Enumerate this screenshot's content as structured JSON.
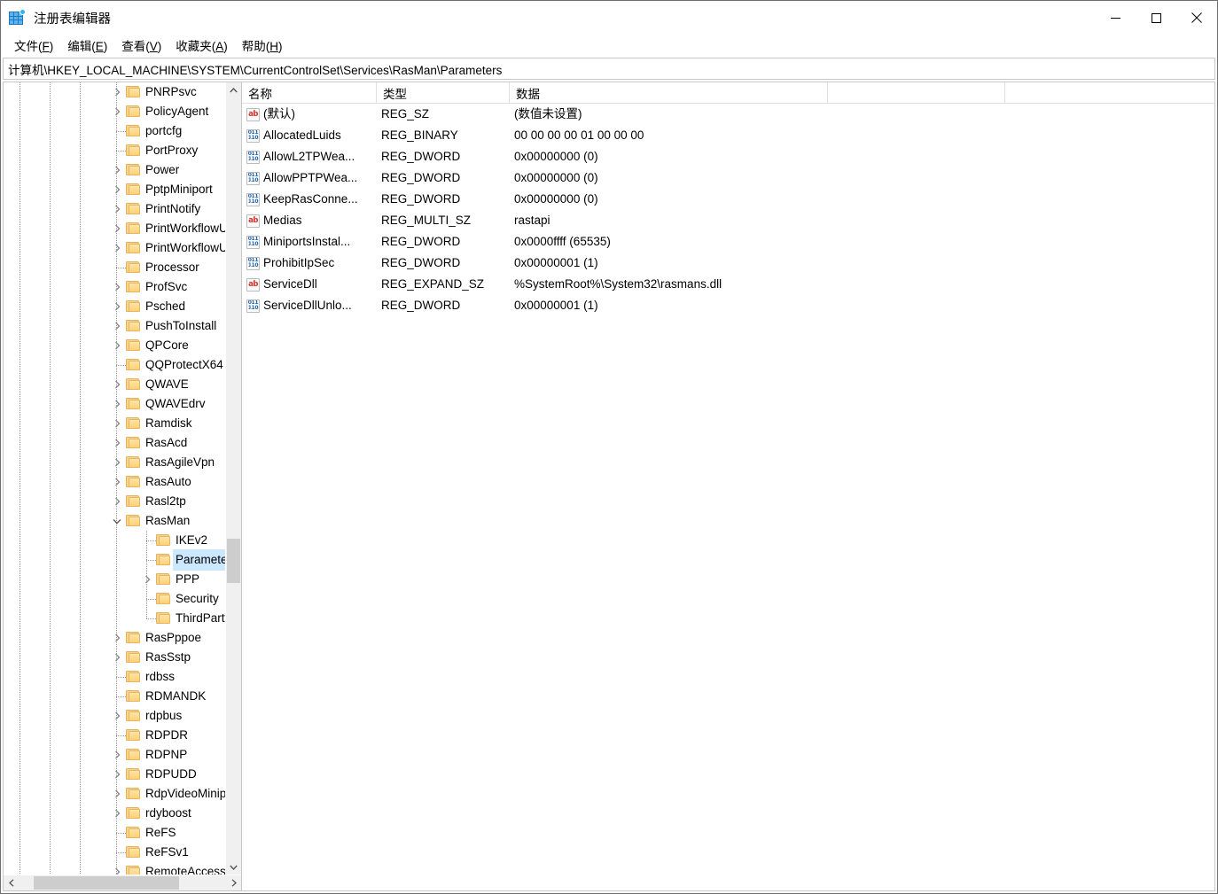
{
  "window": {
    "title": "注册表编辑器",
    "icon": "registry-editor-icon",
    "controls": {
      "minimize": "minimize-icon",
      "maximize": "maximize-icon",
      "close": "close-icon"
    }
  },
  "menubar": {
    "items": [
      {
        "label": "文件(F)",
        "plain": "文件",
        "accel": "F"
      },
      {
        "label": "编辑(E)",
        "plain": "编辑",
        "accel": "E"
      },
      {
        "label": "查看(V)",
        "plain": "查看",
        "accel": "V"
      },
      {
        "label": "收藏夹(A)",
        "plain": "收藏夹",
        "accel": "A"
      },
      {
        "label": "帮助(H)",
        "plain": "帮助",
        "accel": "H"
      }
    ]
  },
  "address": {
    "path": "计算机\\HKEY_LOCAL_MACHINE\\SYSTEM\\CurrentControlSet\\Services\\RasMan\\Parameters"
  },
  "tree": {
    "selected": "Parameters",
    "nodes": [
      {
        "label": "PNRPsvc",
        "depth": 0,
        "expander": "collapsed"
      },
      {
        "label": "PolicyAgent",
        "depth": 0,
        "expander": "collapsed"
      },
      {
        "label": "portcfg",
        "depth": 0,
        "expander": "none"
      },
      {
        "label": "PortProxy",
        "depth": 0,
        "expander": "none"
      },
      {
        "label": "Power",
        "depth": 0,
        "expander": "collapsed"
      },
      {
        "label": "PptpMiniport",
        "depth": 0,
        "expander": "collapsed"
      },
      {
        "label": "PrintNotify",
        "depth": 0,
        "expander": "collapsed"
      },
      {
        "label": "PrintWorkflowUse",
        "depth": 0,
        "expander": "collapsed"
      },
      {
        "label": "PrintWorkflowUse",
        "depth": 0,
        "expander": "collapsed"
      },
      {
        "label": "Processor",
        "depth": 0,
        "expander": "none"
      },
      {
        "label": "ProfSvc",
        "depth": 0,
        "expander": "collapsed"
      },
      {
        "label": "Psched",
        "depth": 0,
        "expander": "collapsed"
      },
      {
        "label": "PushToInstall",
        "depth": 0,
        "expander": "collapsed"
      },
      {
        "label": "QPCore",
        "depth": 0,
        "expander": "collapsed"
      },
      {
        "label": "QQProtectX64",
        "depth": 0,
        "expander": "none"
      },
      {
        "label": "QWAVE",
        "depth": 0,
        "expander": "collapsed"
      },
      {
        "label": "QWAVEdrv",
        "depth": 0,
        "expander": "collapsed"
      },
      {
        "label": "Ramdisk",
        "depth": 0,
        "expander": "collapsed"
      },
      {
        "label": "RasAcd",
        "depth": 0,
        "expander": "collapsed"
      },
      {
        "label": "RasAgileVpn",
        "depth": 0,
        "expander": "collapsed"
      },
      {
        "label": "RasAuto",
        "depth": 0,
        "expander": "collapsed"
      },
      {
        "label": "Rasl2tp",
        "depth": 0,
        "expander": "collapsed"
      },
      {
        "label": "RasMan",
        "depth": 0,
        "expander": "expanded"
      },
      {
        "label": "IKEv2",
        "depth": 1,
        "expander": "none"
      },
      {
        "label": "Parameters",
        "depth": 1,
        "expander": "none",
        "selected": true
      },
      {
        "label": "PPP",
        "depth": 1,
        "expander": "collapsed"
      },
      {
        "label": "Security",
        "depth": 1,
        "expander": "none"
      },
      {
        "label": "ThirdParty",
        "depth": 1,
        "expander": "none"
      },
      {
        "label": "RasPppoe",
        "depth": 0,
        "expander": "collapsed"
      },
      {
        "label": "RasSstp",
        "depth": 0,
        "expander": "collapsed"
      },
      {
        "label": "rdbss",
        "depth": 0,
        "expander": "none"
      },
      {
        "label": "RDMANDK",
        "depth": 0,
        "expander": "none"
      },
      {
        "label": "rdpbus",
        "depth": 0,
        "expander": "collapsed"
      },
      {
        "label": "RDPDR",
        "depth": 0,
        "expander": "none"
      },
      {
        "label": "RDPNP",
        "depth": 0,
        "expander": "collapsed"
      },
      {
        "label": "RDPUDD",
        "depth": 0,
        "expander": "collapsed"
      },
      {
        "label": "RdpVideoMinipor",
        "depth": 0,
        "expander": "collapsed"
      },
      {
        "label": "rdyboost",
        "depth": 0,
        "expander": "collapsed"
      },
      {
        "label": "ReFS",
        "depth": 0,
        "expander": "none"
      },
      {
        "label": "ReFSv1",
        "depth": 0,
        "expander": "none"
      },
      {
        "label": "RemoteAccess",
        "depth": 0,
        "expander": "collapsed"
      }
    ]
  },
  "list": {
    "columns": [
      {
        "label": "名称"
      },
      {
        "label": "类型"
      },
      {
        "label": "数据"
      },
      {
        "label": ""
      }
    ],
    "rows": [
      {
        "icon": "string-value-icon",
        "name": "(默认)",
        "type": "REG_SZ",
        "data": "(数值未设置)"
      },
      {
        "icon": "binary-value-icon",
        "name": "AllocatedLuids",
        "type": "REG_BINARY",
        "data": "00 00 00 00 01 00 00 00"
      },
      {
        "icon": "binary-value-icon",
        "name": "AllowL2TPWea...",
        "type": "REG_DWORD",
        "data": "0x00000000 (0)"
      },
      {
        "icon": "binary-value-icon",
        "name": "AllowPPTPWea...",
        "type": "REG_DWORD",
        "data": "0x00000000 (0)"
      },
      {
        "icon": "binary-value-icon",
        "name": "KeepRasConne...",
        "type": "REG_DWORD",
        "data": "0x00000000 (0)"
      },
      {
        "icon": "string-value-icon",
        "name": "Medias",
        "type": "REG_MULTI_SZ",
        "data": "rastapi"
      },
      {
        "icon": "binary-value-icon",
        "name": "MiniportsInstal...",
        "type": "REG_DWORD",
        "data": "0x0000ffff (65535)"
      },
      {
        "icon": "binary-value-icon",
        "name": "ProhibitIpSec",
        "type": "REG_DWORD",
        "data": "0x00000001 (1)"
      },
      {
        "icon": "string-value-icon",
        "name": "ServiceDll",
        "type": "REG_EXPAND_SZ",
        "data": "%SystemRoot%\\System32\\rasmans.dll"
      },
      {
        "icon": "binary-value-icon",
        "name": "ServiceDllUnlo...",
        "type": "REG_DWORD",
        "data": "0x00000001 (1)"
      }
    ]
  },
  "colors": {
    "selection": "#cce8ff",
    "folder": "#ffd076",
    "string_icon": "#d93025",
    "binary_icon": "#1a5fb4",
    "scrollbar_thumb": "#cdcdcd"
  }
}
